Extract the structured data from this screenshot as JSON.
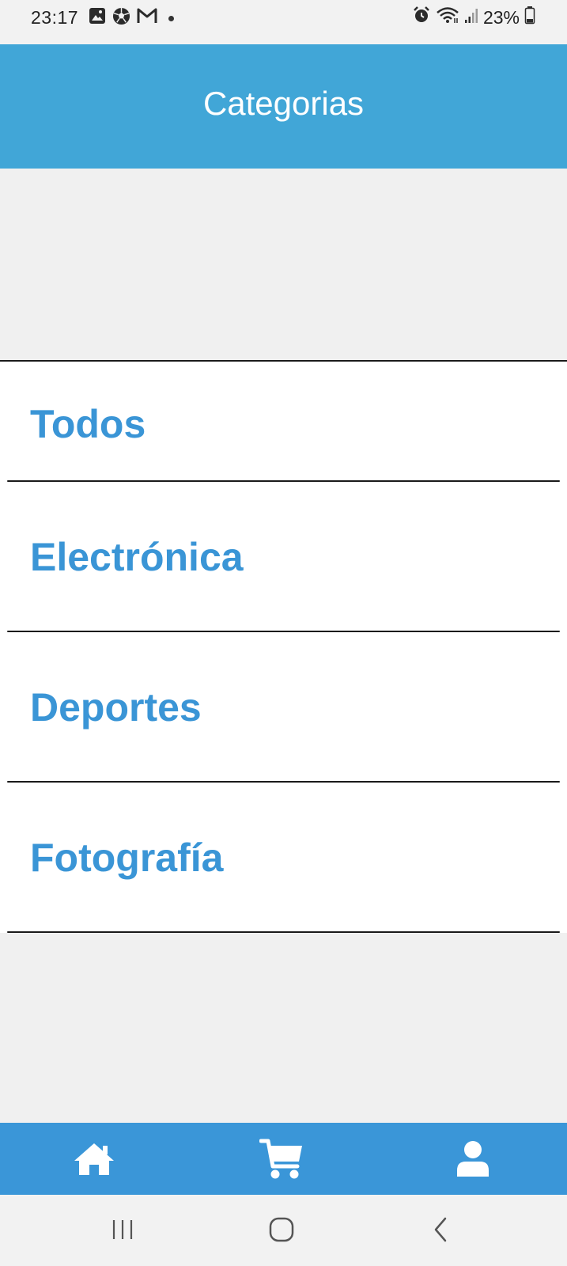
{
  "status_bar": {
    "time": "23:17",
    "battery": "23%",
    "left_icons": [
      "gallery-icon",
      "soccer-ball-icon",
      "gmail-icon",
      "notification-dot-icon"
    ],
    "right_icons": [
      "alarm-icon",
      "wifi-icon",
      "signal-icon",
      "battery-icon"
    ]
  },
  "header": {
    "title": "Categorias",
    "background": "#41a6d7"
  },
  "categories": {
    "items": [
      {
        "label": "Todos"
      },
      {
        "label": "Electrónica"
      },
      {
        "label": "Deportes"
      },
      {
        "label": "Fotografía"
      }
    ],
    "label_color": "#3a95d6"
  },
  "tab_bar": {
    "background": "#3a96d8",
    "tabs": [
      {
        "icon": "home-icon"
      },
      {
        "icon": "cart-icon"
      },
      {
        "icon": "user-icon"
      }
    ]
  },
  "nav_bar": {
    "buttons": [
      {
        "icon": "recent-apps-icon"
      },
      {
        "icon": "home-circle-icon"
      },
      {
        "icon": "back-icon"
      }
    ]
  }
}
